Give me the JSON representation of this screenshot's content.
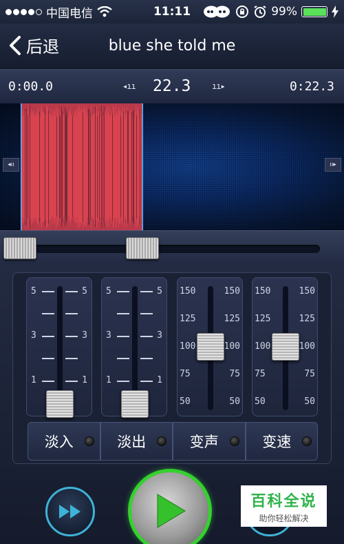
{
  "status_bar": {
    "carrier": "中国电信",
    "time": "11:11",
    "battery": "99%",
    "battery_level": 0.99
  },
  "nav": {
    "back_label": "后退",
    "title": "blue she told me"
  },
  "timebar": {
    "start": "0:00.0",
    "duration": "22.3",
    "end": "0:22.3",
    "nudge_left": "◂ıı",
    "nudge_right": "ıı▸"
  },
  "waveform": {
    "edge_left": "◂ıı",
    "edge_right": "ıı▸",
    "colors": {
      "selection": "#d8434f",
      "background": "#0b2a66"
    }
  },
  "faders": [
    {
      "name": "fade-in",
      "top_label": "5",
      "mid_label": "3",
      "bottom_label": "1",
      "level": 0.0
    },
    {
      "name": "fade-out",
      "top_label": "5",
      "mid_label": "3",
      "bottom_label": "1",
      "level": 0.0
    },
    {
      "name": "pitch",
      "labels": [
        "150",
        "125",
        "100",
        "75",
        "50"
      ],
      "level": 0.5
    },
    {
      "name": "tempo",
      "labels": [
        "150",
        "125",
        "100",
        "75",
        "50"
      ],
      "level": 0.5
    }
  ],
  "effects": {
    "fade_in": "淡入",
    "fade_out": "淡出",
    "pitch": "变声",
    "tempo": "变速"
  },
  "watermark": {
    "title": "百科全说",
    "subtitle": "助你轻松解决"
  }
}
